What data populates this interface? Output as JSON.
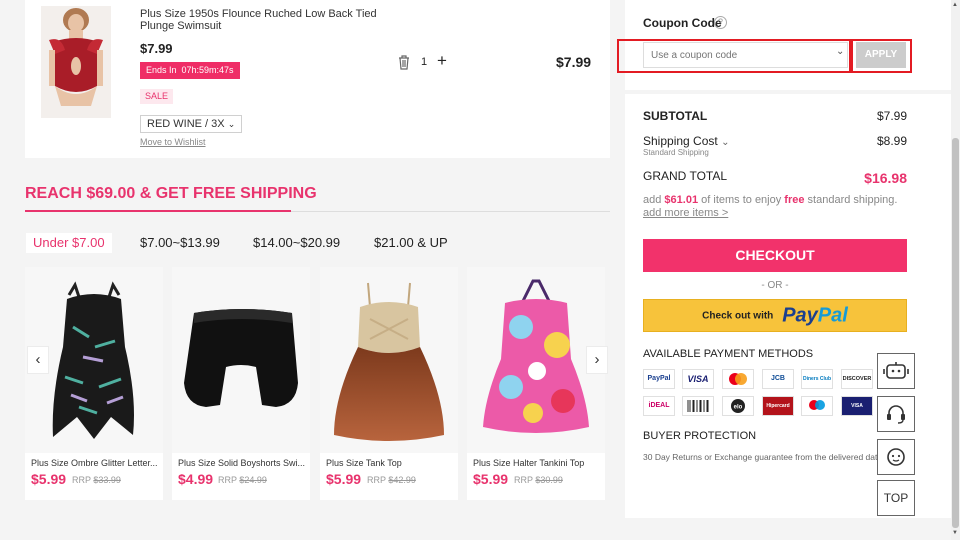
{
  "cart_item": {
    "name": "Plus Size 1950s Flounce Ruched Low Back Tied Plunge Swimsuit",
    "price": "$7.99",
    "ends_in": "Ends In  07h:59m:47s",
    "sale_tag": "SALE",
    "variant": "RED WINE / 3X",
    "move_to_wishlist": "Move to Wishlist",
    "quantity": "1",
    "total": "$7.99"
  },
  "promo": {
    "title": "REACH $69.00 & GET FREE SHIPPING",
    "tabs": [
      "Under $7.00",
      "$7.00~$13.99",
      "$14.00~$20.99",
      "$21.00 & UP"
    ],
    "active_tab": 0,
    "products": [
      {
        "name": "Plus Size Ombre Glitter Letter...",
        "price": "$5.99",
        "rrp_label": "RRP",
        "rrp": "$33.99"
      },
      {
        "name": "Plus Size Solid Boyshorts Swi...",
        "price": "$4.99",
        "rrp_label": "RRP",
        "rrp": "$24.99"
      },
      {
        "name": "Plus Size Tank Top",
        "price": "$5.99",
        "rrp_label": "RRP",
        "rrp": "$42.99"
      },
      {
        "name": "Plus Size Halter Tankini Top",
        "price": "$5.99",
        "rrp_label": "RRP",
        "rrp": "$30.99"
      }
    ]
  },
  "summary": {
    "coupon_label": "Coupon Code",
    "coupon_placeholder": "Use a coupon code",
    "apply": "APPLY",
    "subtotal_label": "SUBTOTAL",
    "subtotal": "$7.99",
    "shipping_label": "Shipping Cost",
    "shipping_sub": "Standard Shipping",
    "shipping": "$8.99",
    "grand_label": "GRAND TOTAL",
    "grand": "$16.98",
    "free_pre": "add",
    "free_amount": "$61.01",
    "free_mid": "of items to enjoy",
    "free_word": "free",
    "free_post": "standard shipping.",
    "add_more": "add more items >",
    "checkout": "CHECKOUT",
    "or": "- OR -",
    "paypal_pre": "Check out with",
    "paypal_a": "Pay",
    "paypal_b": "Pal",
    "payment_title": "AVAILABLE PAYMENT METHODS",
    "payment_methods": [
      "PayPal",
      "VISA",
      "mastercard",
      "JCB",
      "Diners Club",
      "DISCOVER",
      "iDEAL",
      "Boleto",
      "elo",
      "Hipercard",
      "Maestro",
      "VISA Electron"
    ],
    "protection_title": "BUYER PROTECTION",
    "protection_text": "30 Day Returns or Exchange guarantee from the delivered date."
  },
  "floating": {
    "top": "TOP"
  },
  "colors": {
    "accent": "#e8336d",
    "checkout": "#f2326b",
    "paypal": "#f7c33b"
  }
}
